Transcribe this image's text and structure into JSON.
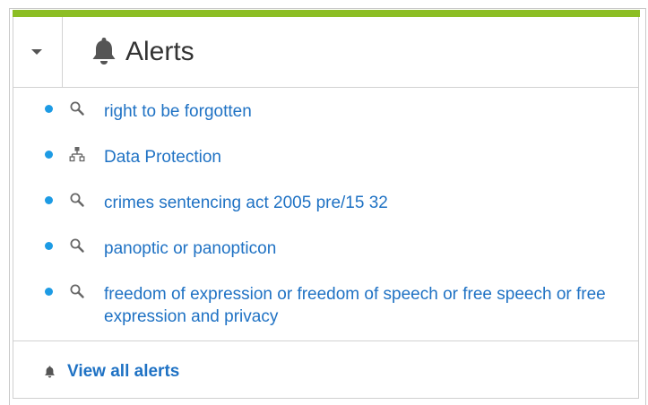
{
  "colors": {
    "accent_bar": "#8cbe24",
    "link": "#1f72c4",
    "bullet": "#1d9be4",
    "icon": "#666666",
    "bell": "#555555"
  },
  "header": {
    "toggle_icon": "caret-down-icon",
    "bell_icon": "bell-icon",
    "title": "Alerts"
  },
  "alerts": [
    {
      "icon": "search-icon",
      "label": "right to be forgotten"
    },
    {
      "icon": "sitemap-icon",
      "label": "Data Protection"
    },
    {
      "icon": "search-icon",
      "label": "crimes sentencing act 2005 pre/15 32"
    },
    {
      "icon": "search-icon",
      "label": "panoptic or panopticon"
    },
    {
      "icon": "search-icon",
      "label": "freedom of expression or freedom of speech or free speech or free expression and privacy"
    }
  ],
  "footer": {
    "bell_icon": "bell-icon",
    "view_all_label": "View all alerts"
  }
}
